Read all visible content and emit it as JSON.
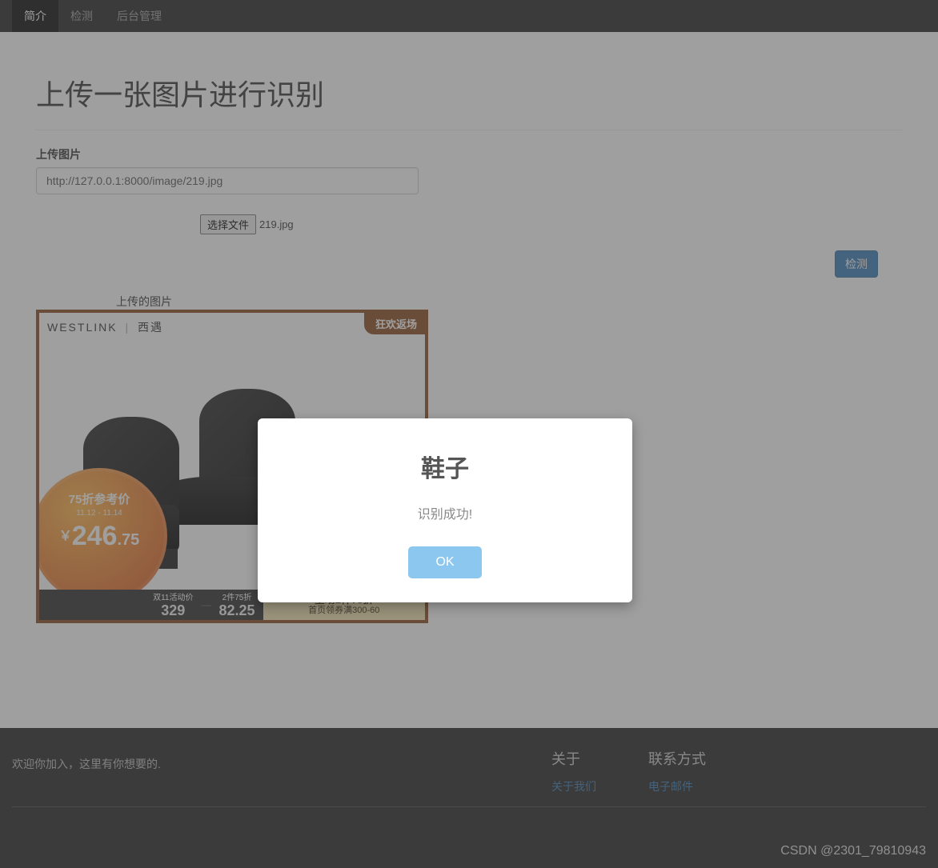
{
  "nav": {
    "items": [
      {
        "label": "简介",
        "active": true
      },
      {
        "label": "检测",
        "active": false
      },
      {
        "label": "后台管理",
        "active": false
      }
    ]
  },
  "page": {
    "title": "上传一张图片进行识别",
    "upload_label": "上传图片",
    "url_value": "http://127.0.0.1:8000/image/219.jpg",
    "choose_file_label": "选择文件",
    "chosen_filename": "219.jpg",
    "detect_button": "检测",
    "uploaded_caption": "上传的图片"
  },
  "product": {
    "brand_en": "WESTLINK",
    "brand_cn": "西遇",
    "top_badge": "狂欢返场",
    "ref_title": "75折参考价",
    "ref_date": "11.12 - 11.14",
    "ref_price_int": "246",
    "ref_price_dec": ".75",
    "currency": "￥",
    "bot_label1": "双11活动价",
    "bot_num1": "329",
    "bot_label2": "2件75折",
    "bot_num2": "82.25",
    "promo_line1": "全场2件75折",
    "promo_line2": "首页领券满300-60"
  },
  "footer": {
    "welcome": "欢迎你加入，这里有你想要的.",
    "col1_title": "关于",
    "col1_link": "关于我们",
    "col2_title": "联系方式",
    "col2_link": "电子邮件"
  },
  "watermark": "CSDN @2301_79810943",
  "modal": {
    "title": "鞋子",
    "message": "识别成功!",
    "ok": "OK"
  }
}
